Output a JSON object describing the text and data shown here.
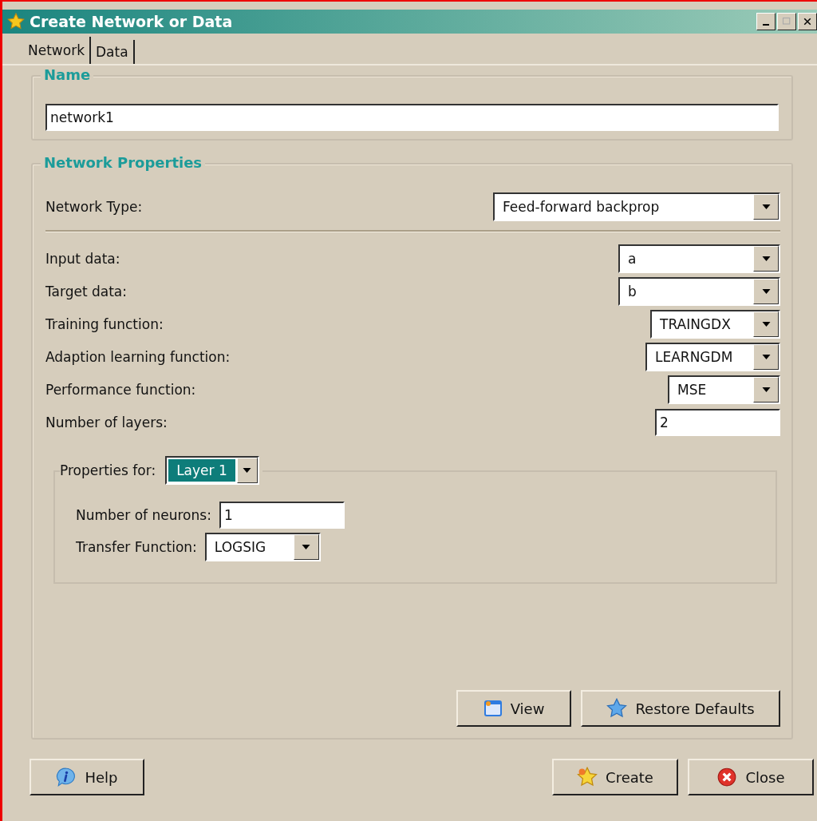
{
  "window": {
    "title": "Create Network or Data"
  },
  "tabs": [
    {
      "label": "Network",
      "selected": true
    },
    {
      "label": "Data",
      "selected": false
    }
  ],
  "name_group": {
    "title": "Name",
    "value": "network1"
  },
  "properties": {
    "title": "Network Properties",
    "network_type": {
      "label": "Network Type:",
      "value": "Feed-forward backprop"
    },
    "fields": [
      {
        "kind": "dropdown",
        "label": "Input data:",
        "value": "a"
      },
      {
        "kind": "dropdown",
        "label": "Target data:",
        "value": "b"
      },
      {
        "kind": "dropdown",
        "label": "Training function:",
        "value": "TRAINGDX"
      },
      {
        "kind": "dropdown",
        "label": "Adaption learning function:",
        "value": "LEARNGDM"
      },
      {
        "kind": "dropdown",
        "label": "Performance function:",
        "value": "MSE"
      },
      {
        "kind": "text",
        "label": "Number of layers:",
        "value": "2"
      }
    ],
    "layer": {
      "label": "Properties for:",
      "value": "Layer 1",
      "fields": [
        {
          "kind": "text",
          "label": "Number of neurons:",
          "value": "1"
        },
        {
          "kind": "dropdown",
          "label": "Transfer Function:",
          "value": "LOGSIG"
        }
      ]
    },
    "buttons": [
      "View",
      "Restore Defaults"
    ]
  },
  "footer": {
    "left": [
      "Help"
    ],
    "right": [
      "Create",
      "Close"
    ]
  }
}
